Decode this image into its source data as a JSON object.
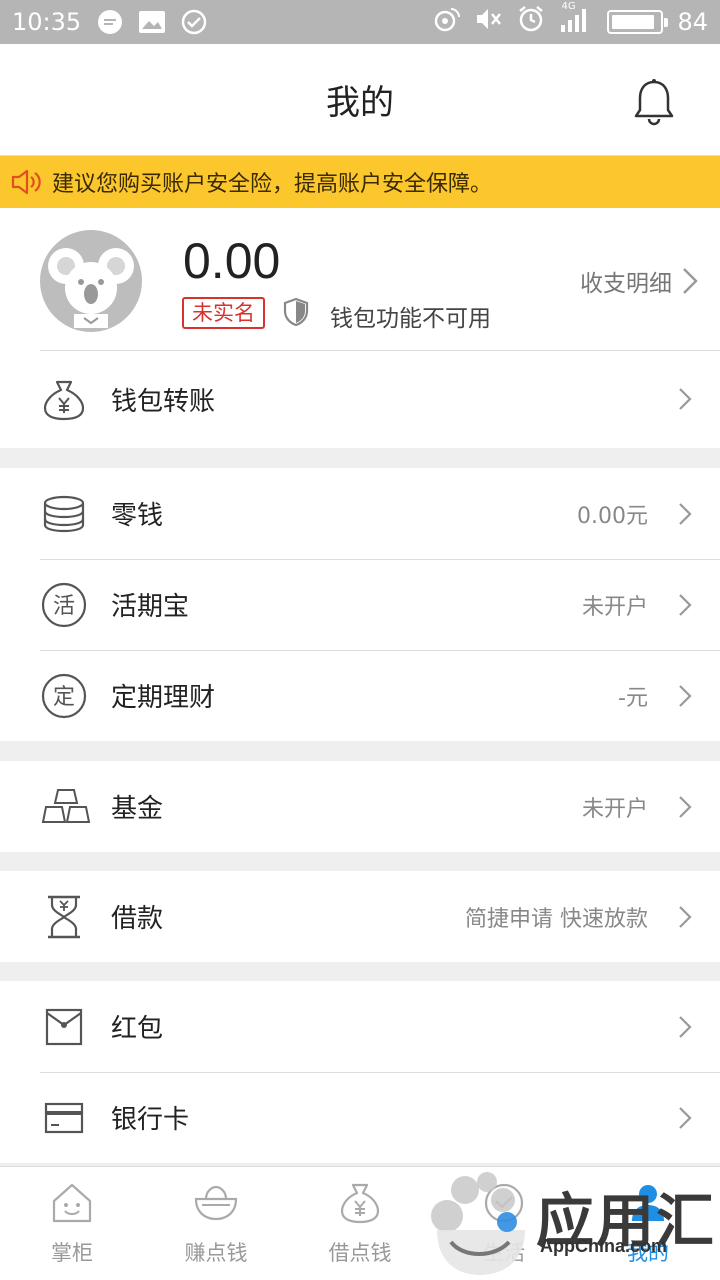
{
  "status_bar": {
    "time": "10:35",
    "network": "4G",
    "battery": "84"
  },
  "header": {
    "title": "我的"
  },
  "notice": {
    "text": "建议您购买账户安全险，提高账户安全保障。"
  },
  "profile": {
    "balance": "0.00",
    "badge": "未实名",
    "wallet_status": "钱包功能不可用",
    "detail_link": "收支明细"
  },
  "groups": [
    {
      "items": [
        {
          "label": "钱包转账",
          "value": "",
          "icon": "money-bag-icon"
        }
      ]
    },
    {
      "items": [
        {
          "label": "零钱",
          "value": "0.00元",
          "icon": "coins-icon"
        },
        {
          "label": "活期宝",
          "value": "未开户",
          "icon": "huo-circle-icon",
          "icon_char": "活"
        },
        {
          "label": "定期理财",
          "value": "-元",
          "icon": "ding-circle-icon",
          "icon_char": "定"
        }
      ]
    },
    {
      "items": [
        {
          "label": "基金",
          "value": "未开户",
          "icon": "gold-bars-icon"
        }
      ]
    },
    {
      "items": [
        {
          "label": "借款",
          "value": "简捷申请 快速放款",
          "icon": "hourglass-icon"
        }
      ]
    },
    {
      "items": [
        {
          "label": "红包",
          "value": "",
          "icon": "red-envelope-icon"
        },
        {
          "label": "银行卡",
          "value": "",
          "icon": "bank-card-icon"
        }
      ]
    }
  ],
  "tabs": [
    {
      "label": "掌柜",
      "icon": "house-face-icon",
      "active": false
    },
    {
      "label": "赚点钱",
      "icon": "ingot-icon",
      "active": false
    },
    {
      "label": "借点钱",
      "icon": "money-bag-icon",
      "active": false
    },
    {
      "label": "生活",
      "icon": "life-icon",
      "active": false
    },
    {
      "label": "我的",
      "icon": "person-icon",
      "active": true
    }
  ],
  "watermark": {
    "text": "应用汇",
    "sub": "AppChina.com"
  },
  "colors": {
    "notice_bg": "#fbc72d",
    "badge_red": "#d9322e",
    "tab_active": "#1f8fe6"
  }
}
